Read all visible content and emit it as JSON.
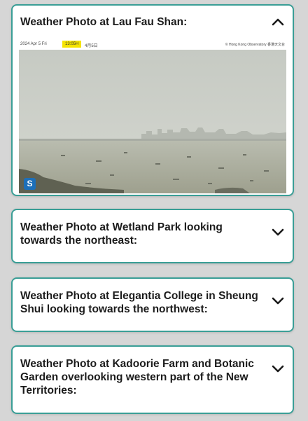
{
  "cards": [
    {
      "title": "Weather Photo at Lau Fau Shan:",
      "expanded": true,
      "chevron_icon": "chevron-up-icon",
      "photo": {
        "date_text": "2024 Apr 5 Fri",
        "time_text": "13:05H",
        "cn_date_text": "4月5日",
        "copyright_text": "© Hong Kong Observatory 香港天文台"
      }
    },
    {
      "title": "Weather Photo at Wetland Park looking towards the northeast:",
      "expanded": false,
      "chevron_icon": "chevron-down-icon"
    },
    {
      "title": "Weather Photo at Elegantia College in Sheung Shui looking towards the northwest:",
      "expanded": false,
      "chevron_icon": "chevron-down-icon"
    },
    {
      "title": "Weather Photo at Kadoorie Farm and Botanic Garden overlooking western part of the New Territories:",
      "expanded": false,
      "chevron_icon": "chevron-down-icon"
    }
  ],
  "colors": {
    "background": "#d6d6d6",
    "card_border": "#3a9e96",
    "time_highlight": "#f5e400"
  }
}
